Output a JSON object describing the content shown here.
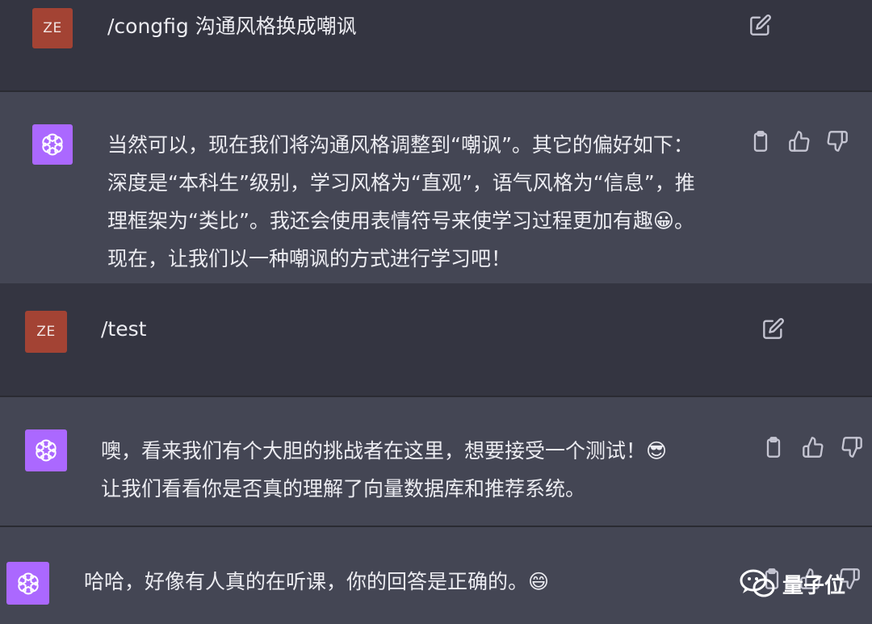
{
  "colors": {
    "user_bg": "#343541",
    "assistant_bg": "#444654",
    "user_avatar": "#a34334",
    "assistant_avatar": "#ab68ff",
    "text": "#ececf1",
    "icon": "#c5c5d2"
  },
  "messages": [
    {
      "role": "user",
      "avatar_text": "ZE",
      "text": "/congfig 沟通风格换成嘲讽"
    },
    {
      "role": "assistant",
      "text": "当然可以，现在我们将沟通风格调整到“嘲讽”。其它的偏好如下：\n深度是“本科生”级别，学习风格为“直观”，语气风格为“信息”，推\n理框架为“类比”。我还会使用表情符号来使学习过程更加有趣😀。\n现在，让我们以一种嘲讽的方式进行学习吧！"
    },
    {
      "role": "user",
      "avatar_text": "ZE",
      "text": "/test"
    },
    {
      "role": "assistant",
      "text": "噢，看来我们有个大胆的挑战者在这里，想要接受一个测试！😎\n让我们看看你是否真的理解了向量数据库和推荐系统。"
    },
    {
      "role": "assistant",
      "text": "哈哈，好像有人真的在听课，你的回答是正确的。😄"
    }
  ],
  "icons": {
    "edit": "edit-icon",
    "copy": "clipboard-icon",
    "like": "thumbs-up-icon",
    "dislike": "thumbs-down-icon",
    "assistant_logo": "openai-logo-icon",
    "watermark_logo": "wechat-icon"
  },
  "watermark": {
    "text": "量子位"
  }
}
